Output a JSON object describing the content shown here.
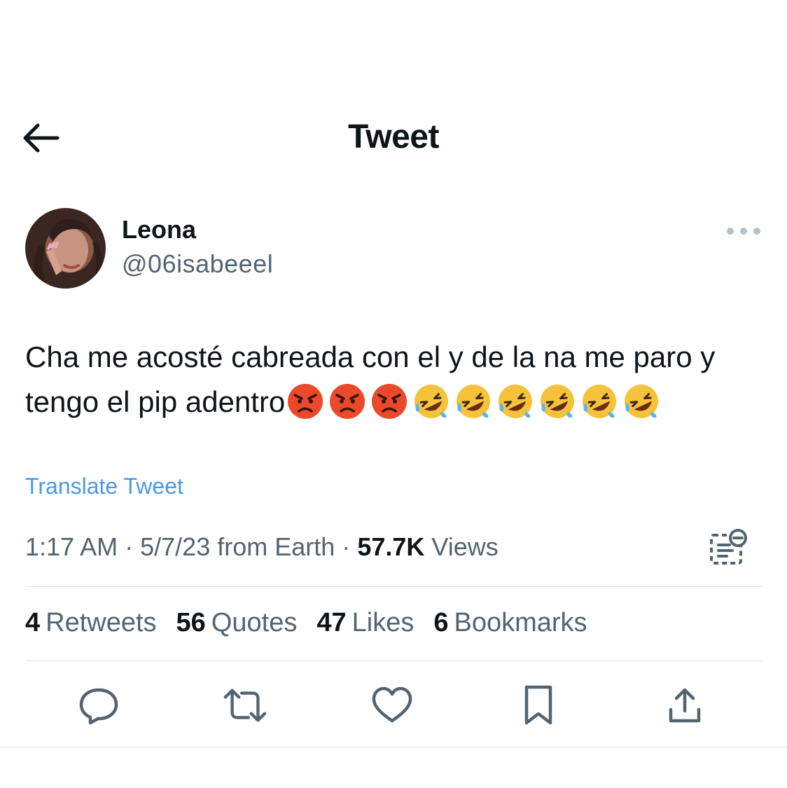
{
  "header": {
    "title": "Tweet",
    "back_icon": "arrow-left-icon"
  },
  "author": {
    "name": "Leona",
    "handle": "@06isabeeel",
    "more_icon": "more-horizontal-icon"
  },
  "tweet": {
    "text": "Cha me acosté cabreada con el y de la na me paro y tengo el pip adentro",
    "emojis": [
      "angry-face",
      "angry-face",
      "angry-face",
      "rolling-on-floor-laughing",
      "rolling-on-floor-laughing",
      "rolling-on-floor-laughing",
      "rolling-on-floor-laughing",
      "rolling-on-floor-laughing",
      "rolling-on-floor-laughing"
    ],
    "translate_label": "Translate Tweet"
  },
  "meta": {
    "time": "1:17 AM",
    "date": "5/7/23",
    "source": "from Earth",
    "views_count": "57.7K",
    "views_label": "Views",
    "separator": "·"
  },
  "stats": [
    {
      "count": "4",
      "label": "Retweets"
    },
    {
      "count": "56",
      "label": "Quotes"
    },
    {
      "count": "47",
      "label": "Likes"
    },
    {
      "count": "6",
      "label": "Bookmarks"
    }
  ],
  "actions": [
    "reply-icon",
    "retweet-icon",
    "like-icon",
    "bookmark-icon",
    "share-icon"
  ],
  "colors": {
    "link": "#4a99e9",
    "secondary_text": "#536471",
    "primary_text": "#0f1419",
    "divider": "#dfe3e6"
  }
}
